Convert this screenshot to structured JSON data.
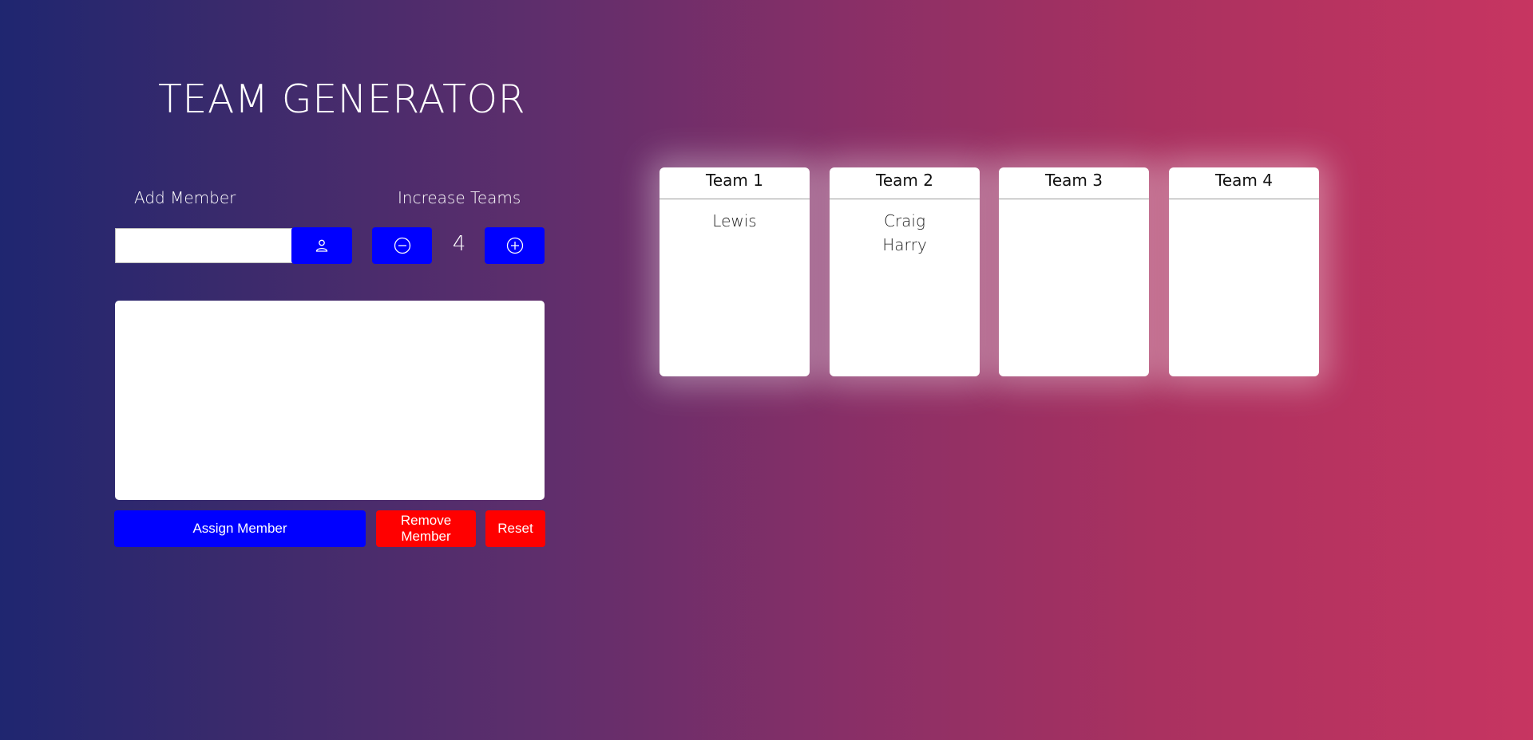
{
  "app": {
    "title": "TEAM GENERATOR"
  },
  "controls": {
    "add_member_label": "Add Member",
    "increase_teams_label": "Increase Teams",
    "member_input_value": "",
    "member_input_placeholder": "",
    "team_count": "4",
    "add_member_icon": "person-icon",
    "decrease_icon": "minus-circle-icon",
    "increase_icon": "plus-circle-icon"
  },
  "actions": {
    "assign_label": "Assign Member",
    "remove_label": "Remove Member",
    "reset_label": "Reset"
  },
  "teams": [
    {
      "name": "Team 1",
      "members": [
        "Lewis"
      ]
    },
    {
      "name": "Team 2",
      "members": [
        "Craig",
        "Harry"
      ]
    },
    {
      "name": "Team 3",
      "members": []
    },
    {
      "name": "Team 4",
      "members": []
    }
  ],
  "colors": {
    "primary_button": "#0000ff",
    "danger_button": "#ff0000",
    "gradient_start": "#1f2670",
    "gradient_end": "#c73561"
  }
}
